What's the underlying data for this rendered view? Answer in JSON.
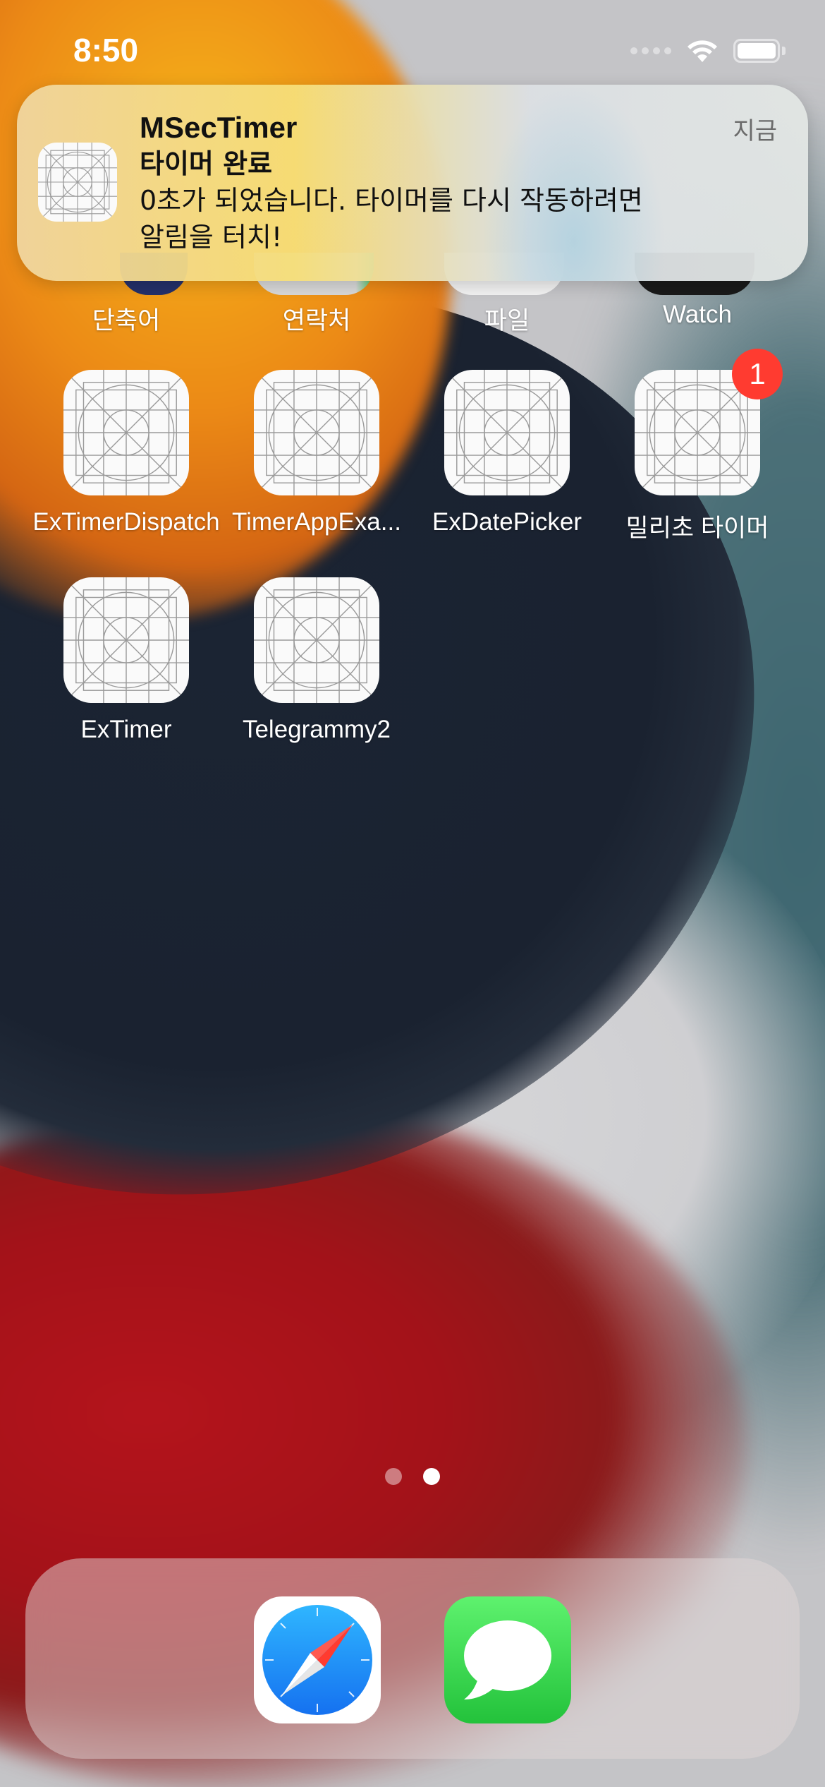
{
  "status_bar": {
    "time": "8:50",
    "icons": [
      "signal-dots-icon",
      "wifi-icon",
      "battery-icon"
    ]
  },
  "notification": {
    "app_name": "MSecTimer",
    "title": "타이머 완료",
    "body_line1": "0초가 되었습니다. 타이머를 다시 작동하려면",
    "body_line2": "알림을 터치!",
    "time": "지금",
    "icon": "app-placeholder-icon"
  },
  "home": {
    "row1_partial": [
      {
        "label": "단축어"
      },
      {
        "label": "연락처"
      },
      {
        "label": "파일"
      },
      {
        "label": "Watch"
      }
    ],
    "apps": [
      {
        "label": "ExTimerDispatch",
        "icon": "app-placeholder-icon"
      },
      {
        "label": "TimerAppExa...",
        "icon": "app-placeholder-icon"
      },
      {
        "label": "ExDatePicker",
        "icon": "app-placeholder-icon"
      },
      {
        "label": "밀리초 타이머",
        "icon": "app-placeholder-icon",
        "badge": "1"
      },
      {
        "label": "ExTimer",
        "icon": "app-placeholder-icon"
      },
      {
        "label": "Telegrammy2",
        "icon": "app-placeholder-icon"
      }
    ],
    "page_count": 2,
    "current_page": 2
  },
  "dock": {
    "apps": [
      {
        "name": "Safari",
        "icon": "safari-compass-icon"
      },
      {
        "name": "Messages",
        "icon": "messages-bubble-icon"
      }
    ]
  },
  "colors": {
    "badge": "#ff3b30",
    "messages_green": "#23c23b",
    "safari_blue": "#1a8cff"
  }
}
